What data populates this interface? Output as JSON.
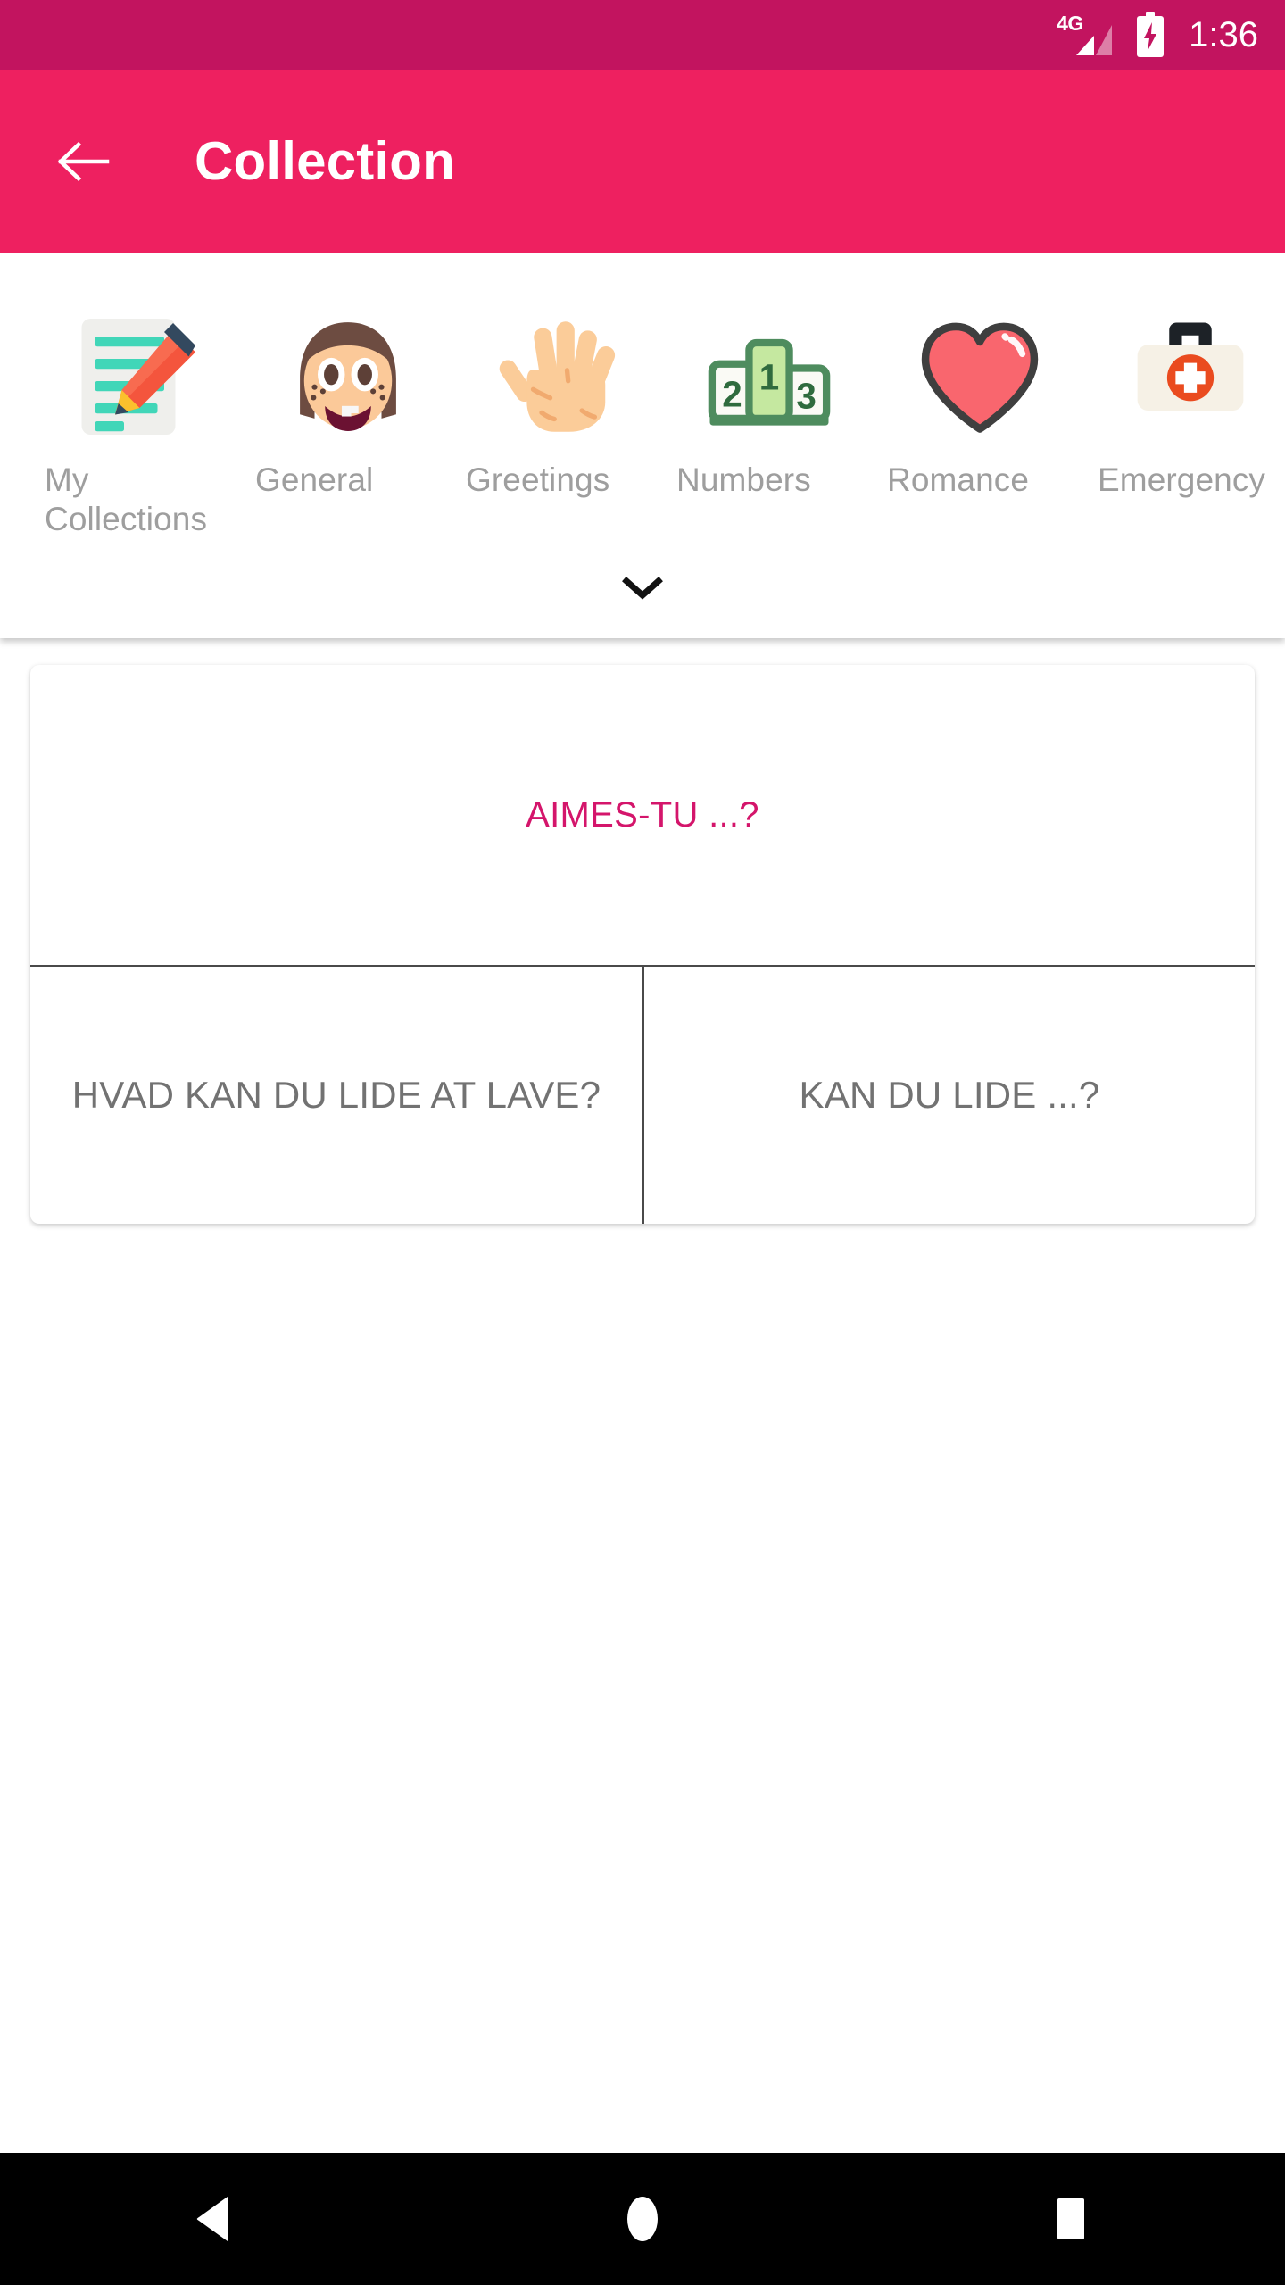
{
  "status_bar": {
    "network_label": "4G",
    "time": "1:36",
    "signal_icon": "signal-triangle-icon",
    "battery_icon": "battery-charging-icon",
    "background_color": "#C2145F"
  },
  "app_bar": {
    "title": "Collection",
    "back_icon": "back-arrow-icon",
    "background_color": "#EE2060",
    "text_color": "#FFFFFF"
  },
  "categories": {
    "expand_icon": "chevron-down-icon",
    "label_color": "#9E9E9E",
    "items": [
      {
        "label": "My Collections",
        "icon": "memo-pencil-icon"
      },
      {
        "label": "General",
        "icon": "girl-face-icon"
      },
      {
        "label": "Greetings",
        "icon": "waving-hand-icon"
      },
      {
        "label": "Numbers",
        "icon": "podium-123-icon"
      },
      {
        "label": "Romance",
        "icon": "heart-icon"
      },
      {
        "label": "Emergency",
        "icon": "first-aid-kit-icon"
      }
    ]
  },
  "phrase_card": {
    "header": {
      "text": "AIMES-TU ...?",
      "color": "#D4156B"
    },
    "cells": [
      {
        "text": "HVAD KAN DU LIDE AT LAVE?",
        "color": "#727272"
      },
      {
        "text": "KAN DU LIDE ...?",
        "color": "#727272"
      }
    ]
  },
  "nav_bar": {
    "background_color": "#000000",
    "buttons": [
      {
        "name": "back",
        "icon": "triangle-back-icon"
      },
      {
        "name": "home",
        "icon": "circle-home-icon"
      },
      {
        "name": "recents",
        "icon": "square-recents-icon"
      }
    ]
  }
}
